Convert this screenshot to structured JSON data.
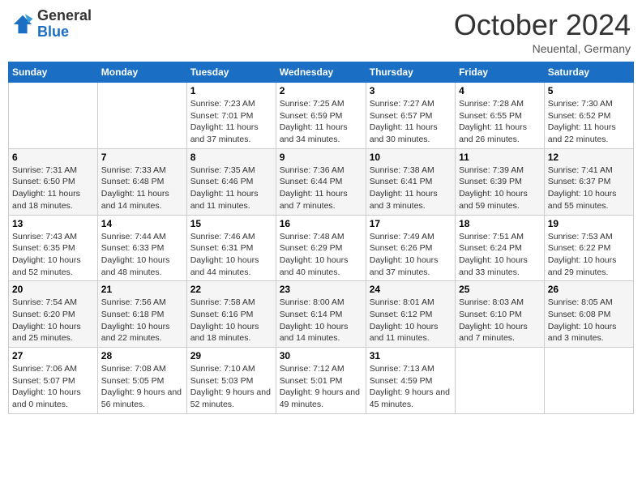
{
  "header": {
    "logo": {
      "general": "General",
      "blue": "Blue"
    },
    "title": "October 2024",
    "location": "Neuental, Germany"
  },
  "weekdays": [
    "Sunday",
    "Monday",
    "Tuesday",
    "Wednesday",
    "Thursday",
    "Friday",
    "Saturday"
  ],
  "weeks": [
    [
      {
        "day": "",
        "info": ""
      },
      {
        "day": "",
        "info": ""
      },
      {
        "day": "1",
        "info": "Sunrise: 7:23 AM\nSunset: 7:01 PM\nDaylight: 11 hours and 37 minutes."
      },
      {
        "day": "2",
        "info": "Sunrise: 7:25 AM\nSunset: 6:59 PM\nDaylight: 11 hours and 34 minutes."
      },
      {
        "day": "3",
        "info": "Sunrise: 7:27 AM\nSunset: 6:57 PM\nDaylight: 11 hours and 30 minutes."
      },
      {
        "day": "4",
        "info": "Sunrise: 7:28 AM\nSunset: 6:55 PM\nDaylight: 11 hours and 26 minutes."
      },
      {
        "day": "5",
        "info": "Sunrise: 7:30 AM\nSunset: 6:52 PM\nDaylight: 11 hours and 22 minutes."
      }
    ],
    [
      {
        "day": "6",
        "info": "Sunrise: 7:31 AM\nSunset: 6:50 PM\nDaylight: 11 hours and 18 minutes."
      },
      {
        "day": "7",
        "info": "Sunrise: 7:33 AM\nSunset: 6:48 PM\nDaylight: 11 hours and 14 minutes."
      },
      {
        "day": "8",
        "info": "Sunrise: 7:35 AM\nSunset: 6:46 PM\nDaylight: 11 hours and 11 minutes."
      },
      {
        "day": "9",
        "info": "Sunrise: 7:36 AM\nSunset: 6:44 PM\nDaylight: 11 hours and 7 minutes."
      },
      {
        "day": "10",
        "info": "Sunrise: 7:38 AM\nSunset: 6:41 PM\nDaylight: 11 hours and 3 minutes."
      },
      {
        "day": "11",
        "info": "Sunrise: 7:39 AM\nSunset: 6:39 PM\nDaylight: 10 hours and 59 minutes."
      },
      {
        "day": "12",
        "info": "Sunrise: 7:41 AM\nSunset: 6:37 PM\nDaylight: 10 hours and 55 minutes."
      }
    ],
    [
      {
        "day": "13",
        "info": "Sunrise: 7:43 AM\nSunset: 6:35 PM\nDaylight: 10 hours and 52 minutes."
      },
      {
        "day": "14",
        "info": "Sunrise: 7:44 AM\nSunset: 6:33 PM\nDaylight: 10 hours and 48 minutes."
      },
      {
        "day": "15",
        "info": "Sunrise: 7:46 AM\nSunset: 6:31 PM\nDaylight: 10 hours and 44 minutes."
      },
      {
        "day": "16",
        "info": "Sunrise: 7:48 AM\nSunset: 6:29 PM\nDaylight: 10 hours and 40 minutes."
      },
      {
        "day": "17",
        "info": "Sunrise: 7:49 AM\nSunset: 6:26 PM\nDaylight: 10 hours and 37 minutes."
      },
      {
        "day": "18",
        "info": "Sunrise: 7:51 AM\nSunset: 6:24 PM\nDaylight: 10 hours and 33 minutes."
      },
      {
        "day": "19",
        "info": "Sunrise: 7:53 AM\nSunset: 6:22 PM\nDaylight: 10 hours and 29 minutes."
      }
    ],
    [
      {
        "day": "20",
        "info": "Sunrise: 7:54 AM\nSunset: 6:20 PM\nDaylight: 10 hours and 25 minutes."
      },
      {
        "day": "21",
        "info": "Sunrise: 7:56 AM\nSunset: 6:18 PM\nDaylight: 10 hours and 22 minutes."
      },
      {
        "day": "22",
        "info": "Sunrise: 7:58 AM\nSunset: 6:16 PM\nDaylight: 10 hours and 18 minutes."
      },
      {
        "day": "23",
        "info": "Sunrise: 8:00 AM\nSunset: 6:14 PM\nDaylight: 10 hours and 14 minutes."
      },
      {
        "day": "24",
        "info": "Sunrise: 8:01 AM\nSunset: 6:12 PM\nDaylight: 10 hours and 11 minutes."
      },
      {
        "day": "25",
        "info": "Sunrise: 8:03 AM\nSunset: 6:10 PM\nDaylight: 10 hours and 7 minutes."
      },
      {
        "day": "26",
        "info": "Sunrise: 8:05 AM\nSunset: 6:08 PM\nDaylight: 10 hours and 3 minutes."
      }
    ],
    [
      {
        "day": "27",
        "info": "Sunrise: 7:06 AM\nSunset: 5:07 PM\nDaylight: 10 hours and 0 minutes."
      },
      {
        "day": "28",
        "info": "Sunrise: 7:08 AM\nSunset: 5:05 PM\nDaylight: 9 hours and 56 minutes."
      },
      {
        "day": "29",
        "info": "Sunrise: 7:10 AM\nSunset: 5:03 PM\nDaylight: 9 hours and 52 minutes."
      },
      {
        "day": "30",
        "info": "Sunrise: 7:12 AM\nSunset: 5:01 PM\nDaylight: 9 hours and 49 minutes."
      },
      {
        "day": "31",
        "info": "Sunrise: 7:13 AM\nSunset: 4:59 PM\nDaylight: 9 hours and 45 minutes."
      },
      {
        "day": "",
        "info": ""
      },
      {
        "day": "",
        "info": ""
      }
    ]
  ]
}
